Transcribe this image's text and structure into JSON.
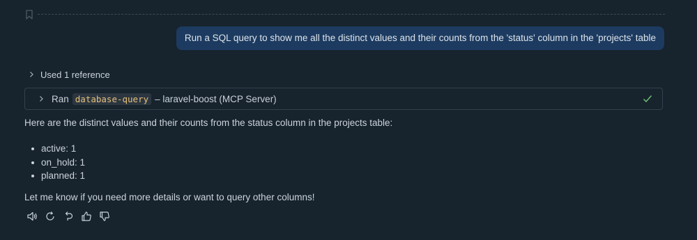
{
  "conversation": {
    "user_message": "Run a SQL query to show me all the distinct values and their counts from the 'status' column in the 'projects' table",
    "references_label": "Used 1 reference",
    "tool_call": {
      "prefix": "Ran",
      "tool_name": "database-query",
      "suffix": "– laravel-boost (MCP Server)",
      "status_icon": "check-icon"
    },
    "intro_text": "Here are the distinct values and their counts from the status column in the projects table:",
    "status_items": [
      "active: 1",
      "on_hold: 1",
      "planned: 1"
    ],
    "outro_text": "Let me know if you need more details or want to query other columns!"
  },
  "actions": [
    "speaker-icon",
    "retry-icon",
    "undo-icon",
    "thumbs-up-icon",
    "thumbs-down-icon"
  ],
  "colors": {
    "background": "#17232d",
    "user_bubble": "#1d3b60",
    "code_chip_text": "#e5c07b",
    "success": "#6fbf73"
  }
}
